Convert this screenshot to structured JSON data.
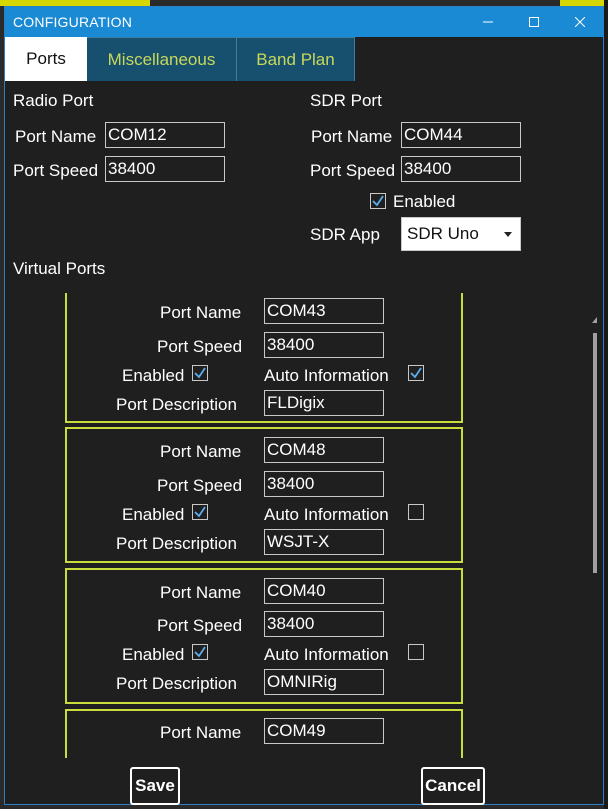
{
  "window": {
    "title": "CONFIGURATION"
  },
  "tabs": [
    {
      "label": "Ports",
      "active": true
    },
    {
      "label": "Miscellaneous",
      "active": false
    },
    {
      "label": "Band Plan",
      "active": false
    }
  ],
  "radio_port": {
    "heading": "Radio Port",
    "port_name_label": "Port Name",
    "port_name": "COM12",
    "port_speed_label": "Port Speed",
    "port_speed": "38400"
  },
  "sdr_port": {
    "heading": "SDR Port",
    "port_name_label": "Port Name",
    "port_name": "COM44",
    "port_speed_label": "Port Speed",
    "port_speed": "38400",
    "enabled_label": "Enabled",
    "enabled": true,
    "sdr_app_label": "SDR App",
    "sdr_app": "SDR Uno"
  },
  "virtual_ports": {
    "heading": "Virtual Ports",
    "labels": {
      "port_name": "Port Name",
      "port_speed": "Port Speed",
      "enabled": "Enabled",
      "auto_information": "Auto Information",
      "port_description": "Port Description"
    },
    "items": [
      {
        "port_name": "COM43",
        "port_speed": "38400",
        "enabled": true,
        "auto_information": true,
        "port_description": "FLDigix"
      },
      {
        "port_name": "COM48",
        "port_speed": "38400",
        "enabled": true,
        "auto_information": false,
        "port_description": "WSJT-X"
      },
      {
        "port_name": "COM40",
        "port_speed": "38400",
        "enabled": true,
        "auto_information": false,
        "port_description": "OMNIRig"
      },
      {
        "port_name": "COM49"
      }
    ]
  },
  "buttons": {
    "save": "Save",
    "cancel": "Cancel"
  },
  "colors": {
    "titlebar": "#1a8ad4",
    "accent_border": "#c8dc3c",
    "tab_inactive": "#16506e"
  }
}
